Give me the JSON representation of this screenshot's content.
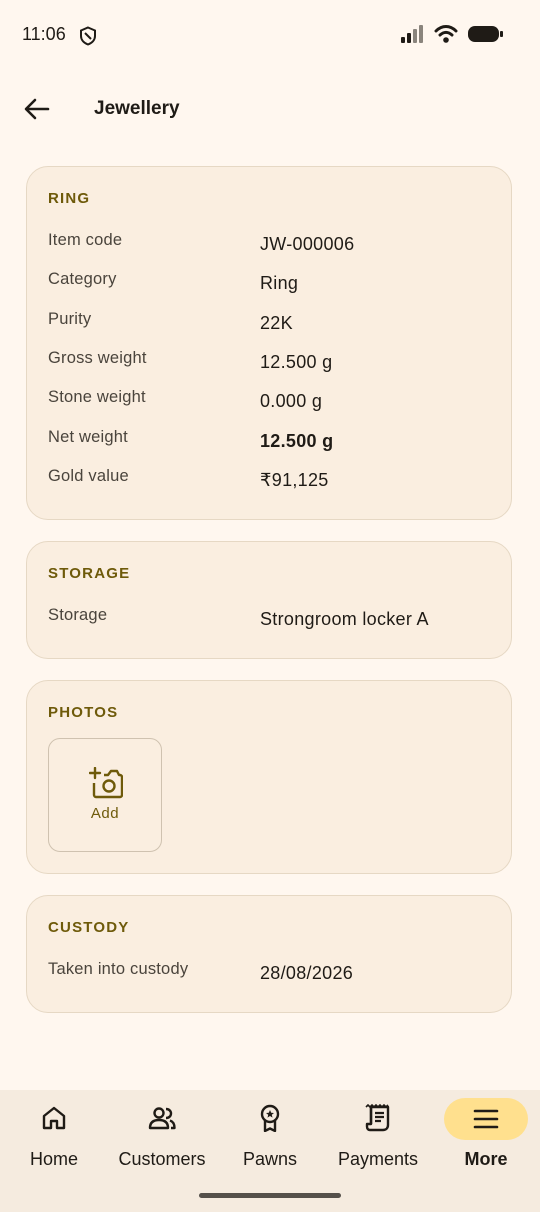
{
  "status_bar": {
    "time": "11:06"
  },
  "app_bar": {
    "title": "Jewellery"
  },
  "item_card": {
    "title": "RING",
    "rows": [
      {
        "label": "Item code",
        "value": "JW-000006"
      },
      {
        "label": "Category",
        "value": "Ring"
      },
      {
        "label": "Purity",
        "value": "22K"
      },
      {
        "label": "Gross weight",
        "value": "12.500 g"
      },
      {
        "label": "Stone weight",
        "value": "0.000 g"
      },
      {
        "label": "Net weight",
        "value": "12.500 g"
      },
      {
        "label": "Gold value",
        "value": "₹91,125"
      }
    ]
  },
  "storage_card": {
    "title": "STORAGE",
    "rows": [
      {
        "label": "Storage",
        "value": "Strongroom locker A"
      }
    ]
  },
  "photos_card": {
    "title": "PHOTOS",
    "add_label": "Add"
  },
  "custody_card": {
    "title": "CUSTODY",
    "rows": [
      {
        "label": "Taken into custody",
        "value": "28/08/2026"
      }
    ]
  },
  "bottom_nav": {
    "items": [
      {
        "label": "Home",
        "icon": "home-icon"
      },
      {
        "label": "Customers",
        "icon": "people-icon"
      },
      {
        "label": "Pawns",
        "icon": "badge-icon"
      },
      {
        "label": "Payments",
        "icon": "receipt-icon"
      },
      {
        "label": "More",
        "icon": "menu-icon",
        "active": true
      }
    ]
  },
  "colors": {
    "background": "#fff7ef",
    "card": "#faeee0",
    "accent_text": "#6e5a0a",
    "active_pill": "#ffe08e"
  }
}
